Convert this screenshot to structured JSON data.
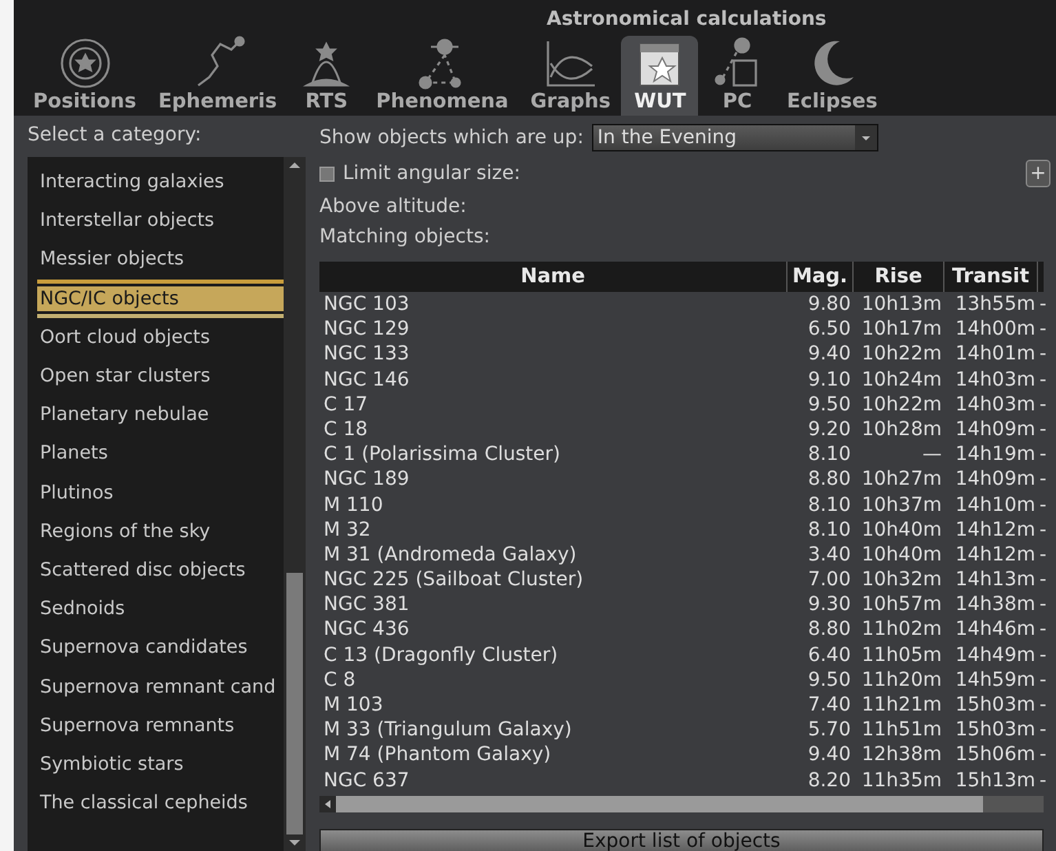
{
  "window": {
    "title": "Astronomical calculations"
  },
  "tabs": [
    {
      "label": "Positions",
      "selected": false
    },
    {
      "label": "Ephemeris",
      "selected": false
    },
    {
      "label": "RTS",
      "selected": false
    },
    {
      "label": "Phenomena",
      "selected": false
    },
    {
      "label": "Graphs",
      "selected": false
    },
    {
      "label": "WUT",
      "selected": true
    },
    {
      "label": "PC",
      "selected": false
    },
    {
      "label": "Eclipses",
      "selected": false
    }
  ],
  "category_label": "Select a category:",
  "categories": [
    {
      "label": "Interacting galaxies",
      "selected": false
    },
    {
      "label": "Interstellar objects",
      "selected": false
    },
    {
      "label": "Messier objects",
      "selected": false
    },
    {
      "label": "NGC/IC objects",
      "selected": true
    },
    {
      "label": "Oort cloud objects",
      "selected": false
    },
    {
      "label": "Open star clusters",
      "selected": false
    },
    {
      "label": "Planetary nebulae",
      "selected": false
    },
    {
      "label": "Planets",
      "selected": false
    },
    {
      "label": "Plutinos",
      "selected": false
    },
    {
      "label": "Regions of the sky",
      "selected": false
    },
    {
      "label": "Scattered disc objects",
      "selected": false
    },
    {
      "label": "Sednoids",
      "selected": false
    },
    {
      "label": "Supernova candidates",
      "selected": false
    },
    {
      "label": "Supernova remnant cand",
      "selected": false
    },
    {
      "label": "Supernova remnants",
      "selected": false
    },
    {
      "label": "Symbiotic stars",
      "selected": false
    },
    {
      "label": "The classical cepheids",
      "selected": false
    }
  ],
  "show_label": "Show objects which are up:",
  "show_value": "In the Evening",
  "limit": {
    "label": "Limit angular size:",
    "checked": false
  },
  "add_button": "+",
  "altitude_label": "Above altitude:",
  "matching_label": "Matching objects:",
  "table": {
    "columns": [
      "Name",
      "Mag.",
      "Rise",
      "Transit"
    ],
    "rows": [
      [
        "NGC 103",
        "9.80",
        "10h13m",
        "13h55m",
        "-"
      ],
      [
        "NGC 129",
        "6.50",
        "10h17m",
        "14h00m",
        "-"
      ],
      [
        "NGC 133",
        "9.40",
        "10h22m",
        "14h01m",
        "-"
      ],
      [
        "NGC 146",
        "9.10",
        "10h24m",
        "14h03m",
        "-"
      ],
      [
        "C 17",
        "9.50",
        "10h22m",
        "14h03m",
        "-"
      ],
      [
        "C 18",
        "9.20",
        "10h28m",
        "14h09m",
        "-"
      ],
      [
        "C 1 (Polarissima Cluster)",
        "8.10",
        "—",
        "14h19m",
        "-"
      ],
      [
        "NGC 189",
        "8.80",
        "10h27m",
        "14h09m",
        "-"
      ],
      [
        "M 110",
        "8.10",
        "10h37m",
        "14h10m",
        "-"
      ],
      [
        "M 32",
        "8.10",
        "10h40m",
        "14h12m",
        "-"
      ],
      [
        "M 31 (Andromeda Galaxy)",
        "3.40",
        "10h40m",
        "14h12m",
        "-"
      ],
      [
        "NGC 225 (Sailboat Cluster)",
        "7.00",
        "10h32m",
        "14h13m",
        "-"
      ],
      [
        "NGC 381",
        "9.30",
        "10h57m",
        "14h38m",
        "-"
      ],
      [
        "NGC 436",
        "8.80",
        "11h02m",
        "14h46m",
        "-"
      ],
      [
        "C 13 (Dragonfly Cluster)",
        "6.40",
        "11h05m",
        "14h49m",
        "-"
      ],
      [
        "C 8",
        "9.50",
        "11h20m",
        "14h59m",
        "-"
      ],
      [
        "M 103",
        "7.40",
        "11h21m",
        "15h03m",
        "-"
      ],
      [
        "M 33 (Triangulum Galaxy)",
        "5.70",
        "11h51m",
        "15h03m",
        "-"
      ],
      [
        "M 74 (Phantom Galaxy)",
        "9.40",
        "12h38m",
        "15h06m",
        "-"
      ],
      [
        "NGC 637",
        "8.20",
        "11h35m",
        "15h13m",
        "-"
      ]
    ]
  },
  "export_button": "Export list of objects"
}
